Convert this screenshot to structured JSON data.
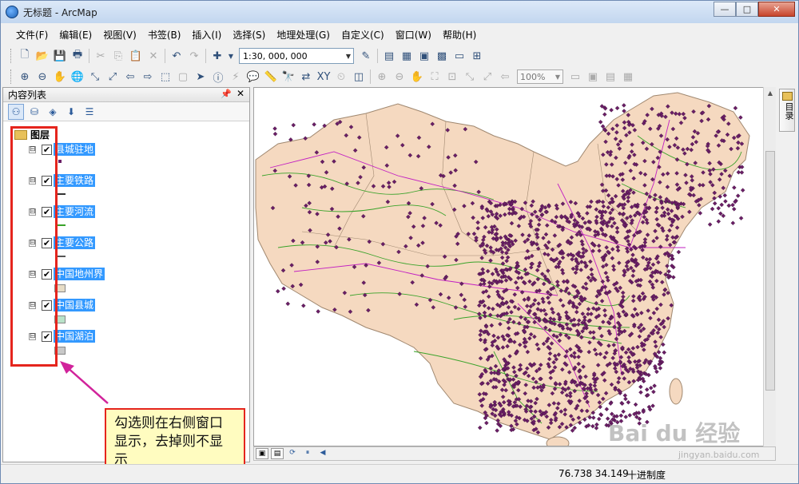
{
  "window": {
    "title": "无标题 - ArcMap",
    "buttons": [
      "—",
      "□",
      "✕"
    ]
  },
  "menu": [
    "文件(F)",
    "编辑(E)",
    "视图(V)",
    "书签(B)",
    "插入(I)",
    "选择(S)",
    "地理处理(G)",
    "自定义(C)",
    "窗口(W)",
    "帮助(H)"
  ],
  "toolbar": {
    "scale": "1:30, 000, 000",
    "zoom": "100%"
  },
  "toc": {
    "title": "内容列表",
    "root": "图层",
    "layers": [
      {
        "name": "县城驻地",
        "checked": true,
        "expander": "⊟",
        "symbol": "point"
      },
      {
        "name": "主要铁路",
        "checked": true,
        "expander": "⊟",
        "symbol": "line-dark"
      },
      {
        "name": "主要河流",
        "checked": true,
        "expander": "⊟",
        "symbol": "line-green"
      },
      {
        "name": "主要公路",
        "checked": true,
        "expander": "⊟",
        "symbol": "line-magenta"
      },
      {
        "name": "中国地州界",
        "checked": true,
        "expander": "⊟",
        "symbol": "polygon-beige"
      },
      {
        "name": "中国县城",
        "checked": true,
        "expander": "⊟",
        "symbol": "polygon-green"
      },
      {
        "name": "中国湖泊",
        "checked": true,
        "expander": "⊟",
        "symbol": "polygon-gray"
      }
    ]
  },
  "callout": {
    "text": "勾选则在右侧窗口显示，去掉则不显示"
  },
  "dock": {
    "label": "目录"
  },
  "status": {
    "coords": "76.738  34.149",
    "units": "十进制度"
  },
  "watermark": {
    "brand": "Bai du 经验",
    "url": "jingyan.baidu.com"
  },
  "colors": {
    "land": "#f5d9c0",
    "river": "#3aa32a",
    "road": "#c21fc2",
    "county": "#6a1e66",
    "highlight": "#3399ff",
    "callout_border": "#e5251d",
    "callout_bg": "#fffcc0"
  }
}
